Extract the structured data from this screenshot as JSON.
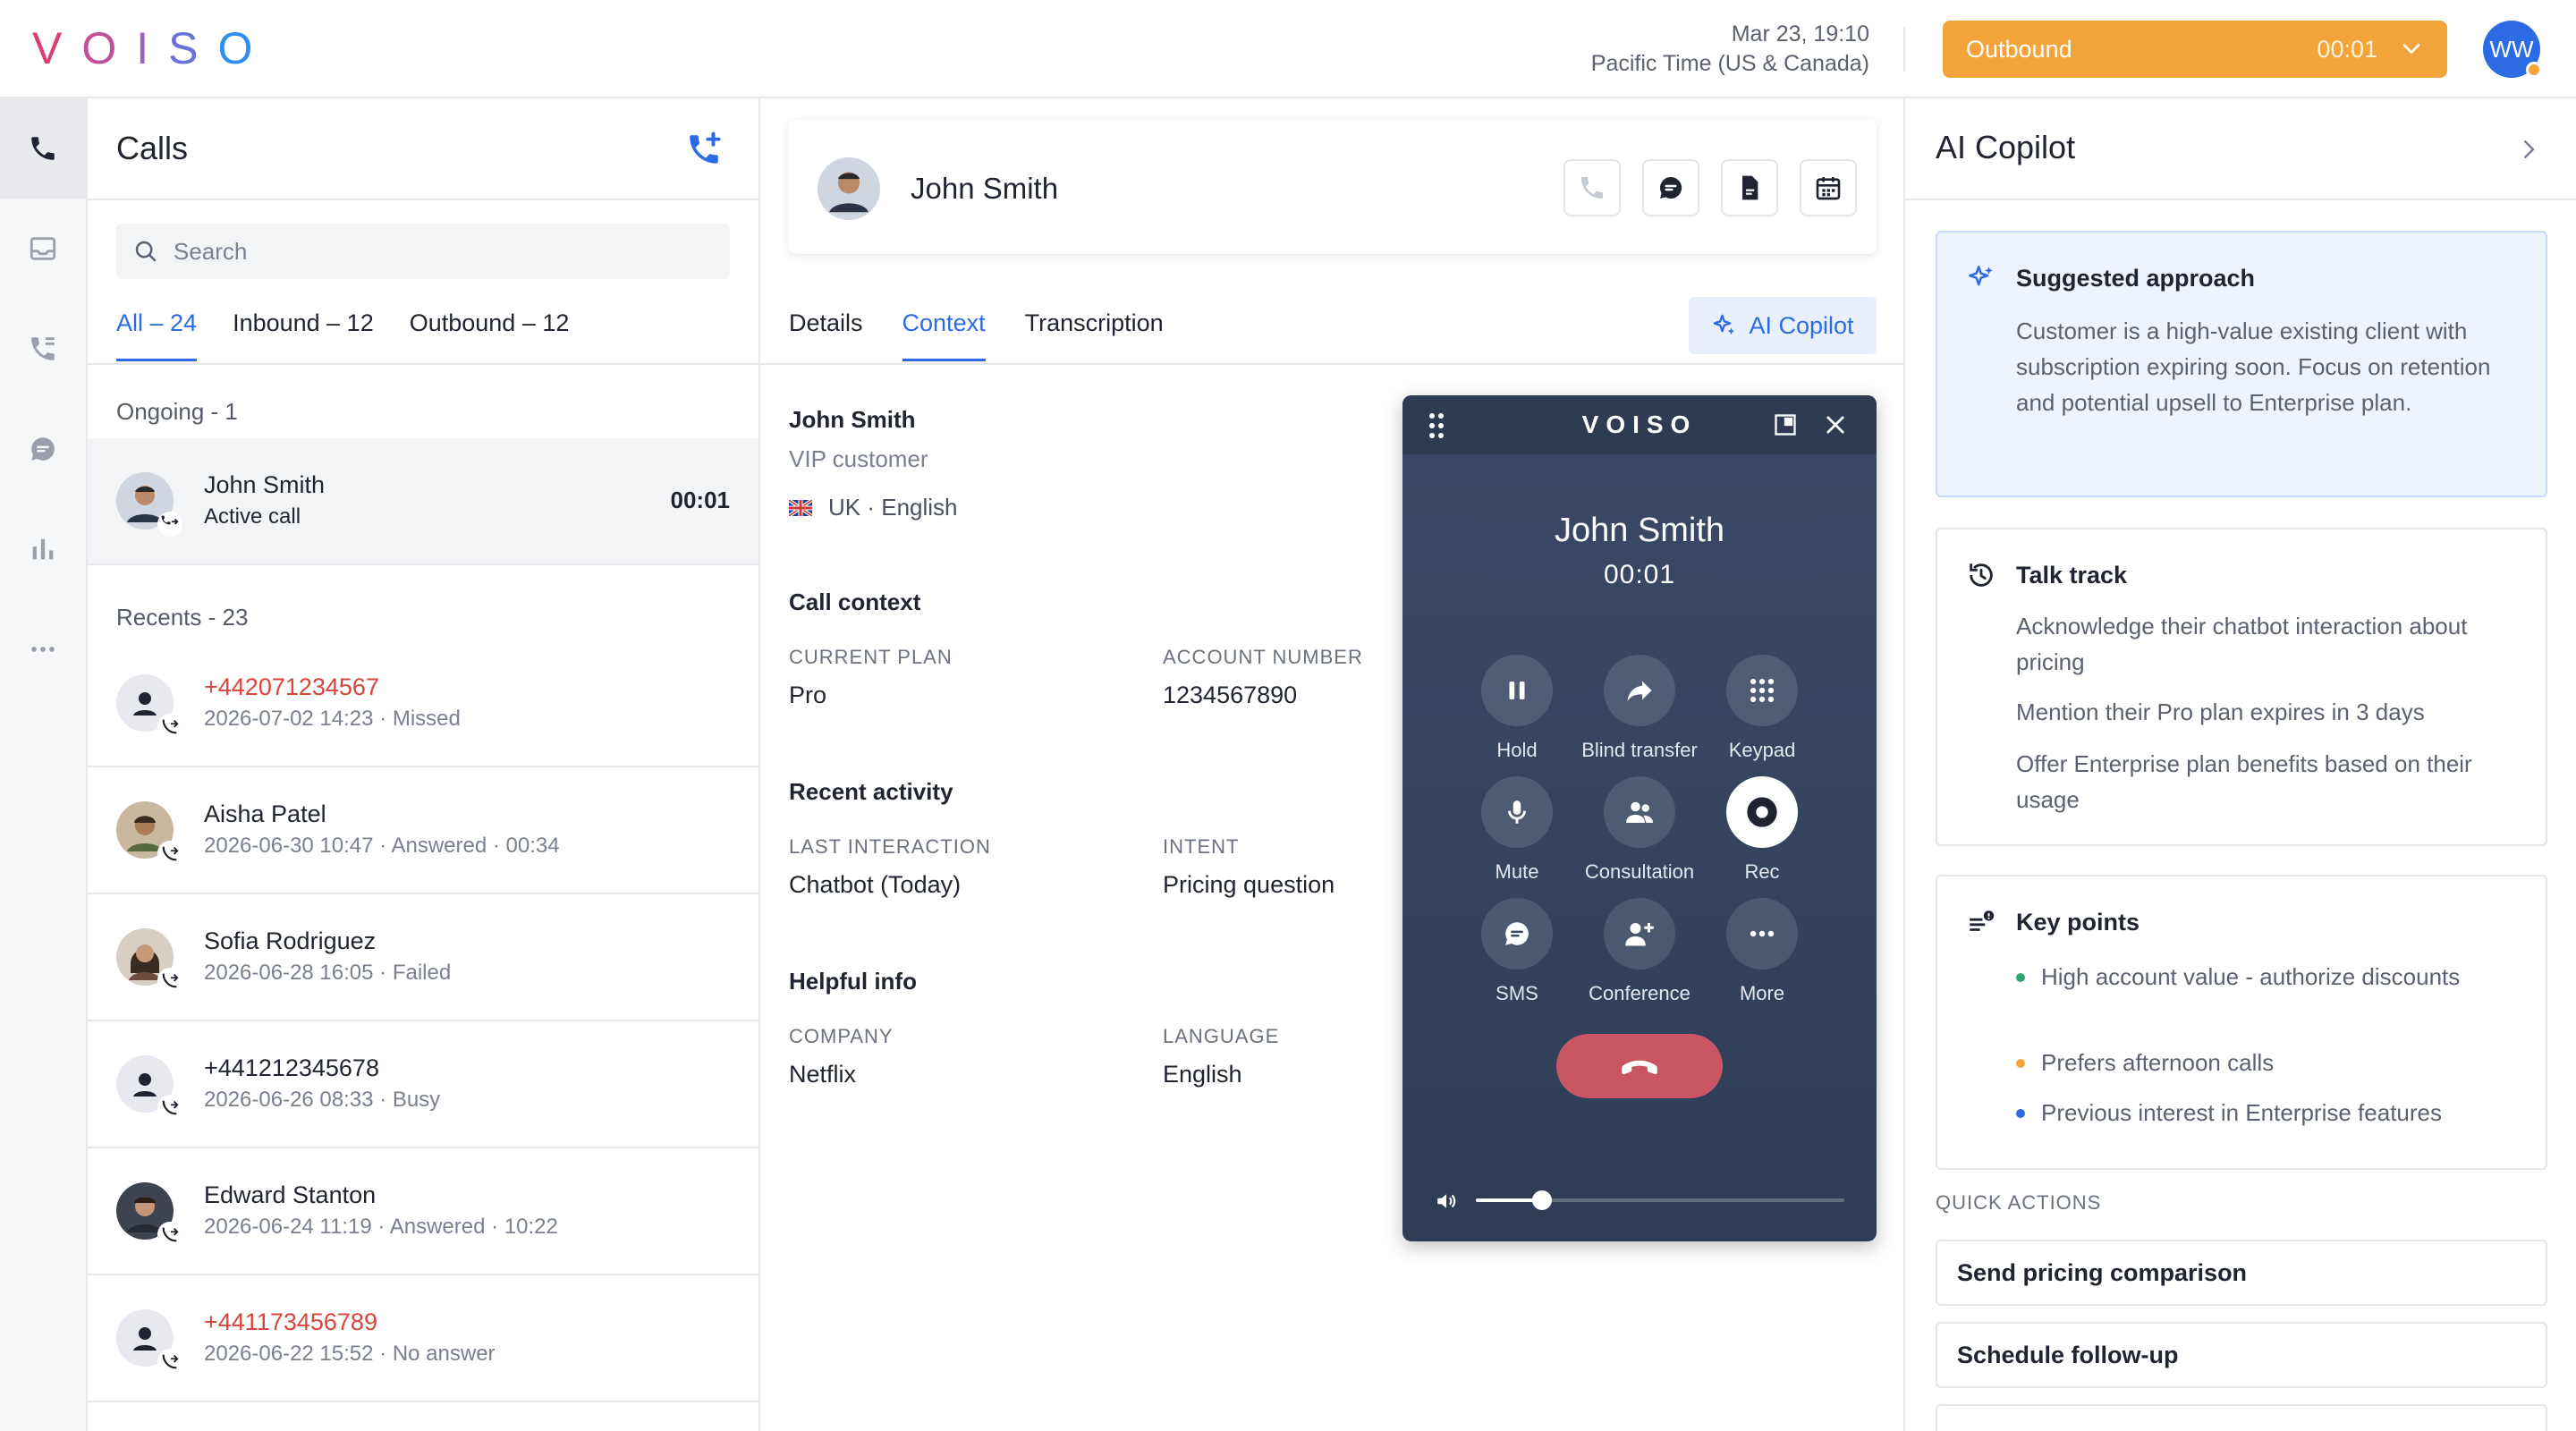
{
  "app": {
    "logo_letters": [
      "V",
      "O",
      "I",
      "S",
      "O"
    ],
    "logo_colors": [
      "#d93e74",
      "#c24f9a",
      "#9b62c2",
      "#6a72d6",
      "#2d8ff0"
    ],
    "datetime": "Mar 23, 19:10",
    "timezone": "Pacific Time (US & Canada)",
    "status": {
      "label": "Outbound",
      "timer": "00:01",
      "color": "#f2a43a"
    },
    "user_initials": "WW",
    "accent": "#2d6be4",
    "missed_color": "#d8453b"
  },
  "rail": {
    "items": [
      "phone-icon",
      "inbox-icon",
      "call-log-icon",
      "chat-icon",
      "stats-icon",
      "more-icon"
    ]
  },
  "calls": {
    "title": "Calls",
    "search_placeholder": "Search",
    "tabs": [
      "All – 24",
      "Inbound – 12",
      "Outbound – 12"
    ],
    "ongoing_label": "Ongoing - 1",
    "ongoing": {
      "name": "John Smith",
      "status": "Active call",
      "timer": "00:01"
    },
    "recents_label": "Recents - 23",
    "recents": [
      {
        "name": "+442071234567",
        "detail": "2026-07-02 14:23 · Missed",
        "missed": true,
        "photo": false
      },
      {
        "name": "Aisha Patel",
        "detail": "2026-06-30 10:47 · Answered · 00:34",
        "missed": false,
        "photo": true
      },
      {
        "name": "Sofia Rodriguez",
        "detail": "2026-06-28 16:05 · Failed",
        "missed": false,
        "photo": true
      },
      {
        "name": "+441212345678",
        "detail": "2026-06-26 08:33 · Busy",
        "missed": false,
        "photo": false
      },
      {
        "name": "Edward Stanton",
        "detail": "2026-06-24 11:19 · Answered · 10:22",
        "missed": false,
        "photo": true
      },
      {
        "name": "+441173456789",
        "detail": "2026-06-22 15:52 · No answer",
        "missed": true,
        "photo": false
      }
    ]
  },
  "contact": {
    "name": "John Smith",
    "tabs": [
      "Details",
      "Context",
      "Transcription"
    ],
    "ai_button": "AI Copilot",
    "subtitle": "VIP customer",
    "locale": "UK · English",
    "call_context_title": "Call context",
    "current_plan_label": "CURRENT PLAN",
    "current_plan": "Pro",
    "account_number_label": "ACCOUNT NUMBER",
    "account_number": "1234567890",
    "recent_activity_title": "Recent activity",
    "last_interaction_label": "LAST INTERACTION",
    "last_interaction": "Chatbot (Today)",
    "intent_label": "INTENT",
    "intent": "Pricing question",
    "helpful_title": "Helpful info",
    "company_label": "COMPANY",
    "company": "Netflix",
    "language_label": "LANGUAGE",
    "language": "English"
  },
  "softphone": {
    "brand": "VOISO",
    "name": "John Smith",
    "timer": "00:01",
    "buttons": [
      "Hold",
      "Blind transfer",
      "Keypad",
      "Mute",
      "Consultation",
      "Rec",
      "SMS",
      "Conference",
      "More"
    ],
    "volume": 0.18
  },
  "copilot": {
    "title": "AI Copilot",
    "suggested_title": "Suggested approach",
    "suggested_body": "Customer is a high-value existing client with subscription expiring soon. Focus on retention and potential upsell to Enterprise plan.",
    "talk_title": "Talk track",
    "talk_items": [
      "Acknowledge their chatbot interaction about pricing",
      "Mention their Pro plan expires in 3 days",
      "Offer Enterprise plan benefits based on their usage"
    ],
    "key_title": "Key points",
    "key_items": [
      {
        "text": "High account value - authorize discounts",
        "color": "#2fa86a"
      },
      {
        "text": "Prefers afternoon calls",
        "color": "#f2a43a"
      },
      {
        "text": "Previous interest in Enterprise features",
        "color": "#2d6be4"
      }
    ],
    "quick_label": "QUICK ACTIONS",
    "quick_actions": [
      "Send pricing comparison",
      "Schedule follow-up"
    ]
  }
}
